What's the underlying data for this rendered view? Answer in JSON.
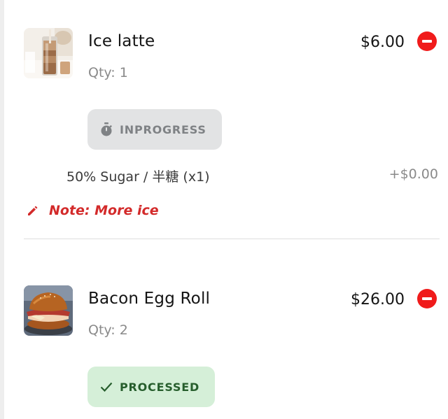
{
  "order_items": [
    {
      "name": "Ice latte",
      "price": "$6.00",
      "qty": "Qty: 1",
      "status": "INPROGRESS",
      "image_icon": "iced-latte-image",
      "status_icon": "stopwatch-icon",
      "options": [
        {
          "label": "50% Sugar / 半糖 (x1)",
          "price": "+$0.00"
        }
      ],
      "note": "Note: More ice"
    },
    {
      "name": "Bacon Egg Roll",
      "price": "$26.00",
      "qty": "Qty: 2",
      "status": "PROCESSED",
      "image_icon": "bacon-egg-roll-image",
      "status_icon": "check-icon"
    }
  ],
  "colors": {
    "remove": "#f01b1b",
    "note": "#d32a2a",
    "inprogress_bg": "#e2e3e4",
    "inprogress_text": "#7f8285",
    "processed_bg": "#d5efd8",
    "processed_text": "#275e2d"
  }
}
